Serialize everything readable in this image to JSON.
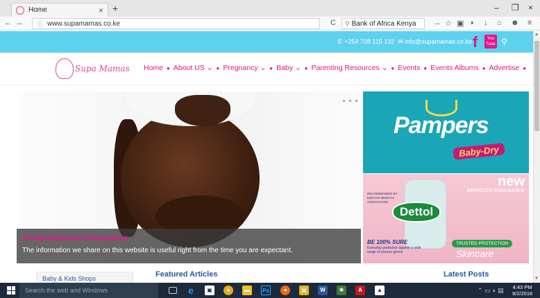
{
  "browser": {
    "tab_title": "Home",
    "tab_close": "×",
    "new_tab": "+",
    "url": "www.supamamas.co.ke",
    "reload": "C",
    "search_value": "Bank of Africa Kenya",
    "window_minimize": "–",
    "window_restore": "❐",
    "window_close": "×"
  },
  "topbar": {
    "phone": "+254 708 115 132",
    "email": "info@supamamas.co.ke",
    "facebook": "f",
    "youtube": "You Tube"
  },
  "header": {
    "logo_text": "Supa Mamas",
    "menu": [
      {
        "label": "Home"
      },
      {
        "label": "About US ⌄"
      },
      {
        "label": "Pregnancy ⌄"
      },
      {
        "label": "Baby ⌄"
      },
      {
        "label": "Parenting Resources ⌄"
      },
      {
        "label": "Events"
      },
      {
        "label": "Events Albums"
      },
      {
        "label": "Advertise"
      }
    ],
    "separator": "●"
  },
  "slider": {
    "caption_title": "Comprehensive Information",
    "caption_text": "The information we share on this website is useful right from the time you are expectant.",
    "dots_count": 5
  },
  "ads": {
    "pampers_brand": "Pampers",
    "pampers_sub": "Baby-Dry",
    "dettol_new": "new",
    "dettol_improved": "IMPROVED FRAGRANCE",
    "dettol_assoc": "RECOMMENDED BY KENYAN MEDICAL ASSOCIATION",
    "dettol_brand": "Dettol",
    "dettol_sure": "BE 100% SURE",
    "dettol_sure_sub": "Everyday protection against a wide range of unseen germs",
    "dettol_trusted": "TRUSTED PROTECTION",
    "dettol_skincare": "Skincare"
  },
  "sections": {
    "kids_shops": "Baby & Kids Shops",
    "featured": "Featured Articles",
    "latest": "Latest Posts"
  },
  "taskbar": {
    "search_placeholder": "Search the web and Windows",
    "time": "4:43 PM",
    "date": "9/2/2016"
  },
  "colors": {
    "accent_pink": "#e0168a",
    "topbar_blue": "#5ed1ee",
    "link_blue": "#2a56a5"
  }
}
